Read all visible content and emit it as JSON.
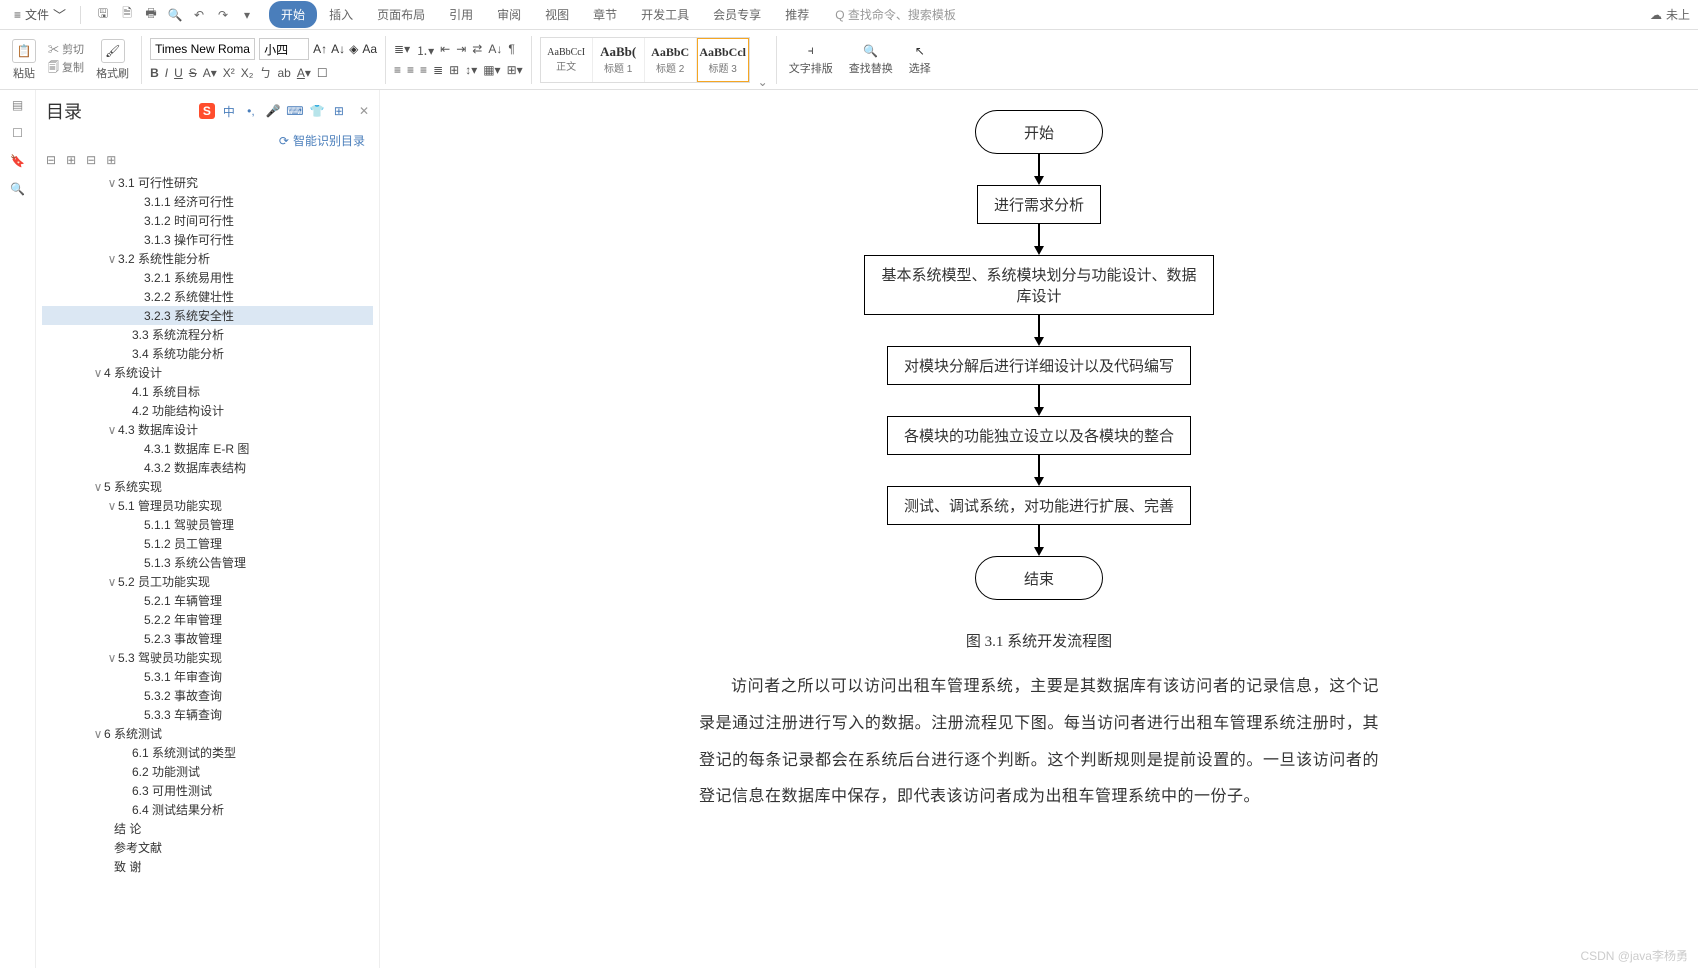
{
  "menubar": {
    "file": "文件",
    "tabs": [
      "开始",
      "插入",
      "页面布局",
      "引用",
      "审阅",
      "视图",
      "章节",
      "开发工具",
      "会员专享",
      "推荐"
    ],
    "active_tab": 0,
    "search_placeholder": "查找命令、搜索模板",
    "search_prefix": "Q",
    "not_logged": "未上"
  },
  "ribbon": {
    "paste": "粘贴",
    "cut": "剪切",
    "copy": "复制",
    "fmt_painter": "格式刷",
    "font_name": "Times New Roma",
    "font_size": "小四",
    "styles": [
      {
        "preview": "AaBbCcI",
        "label": "正文"
      },
      {
        "preview": "AaBb(",
        "label": "标题 1"
      },
      {
        "preview": "AaBbC",
        "label": "标题 2"
      },
      {
        "preview": "AaBbCcl",
        "label": "标题 3"
      }
    ],
    "text_layout": "文字排版",
    "find_replace": "查找替换",
    "select": "选择"
  },
  "sidebar": {
    "title": "目录",
    "smart": "智能识别目录",
    "ime_label": "中"
  },
  "tree": [
    {
      "pad": 64,
      "tw": "∨",
      "text": "3.1 可行性研究"
    },
    {
      "pad": 90,
      "tw": "",
      "text": "3.1.1 经济可行性"
    },
    {
      "pad": 90,
      "tw": "",
      "text": "3.1.2 时间可行性"
    },
    {
      "pad": 90,
      "tw": "",
      "text": "3.1.3 操作可行性"
    },
    {
      "pad": 64,
      "tw": "∨",
      "text": "3.2 系统性能分析"
    },
    {
      "pad": 90,
      "tw": "",
      "text": "3.2.1 系统易用性"
    },
    {
      "pad": 90,
      "tw": "",
      "text": "3.2.2 系统健壮性"
    },
    {
      "pad": 90,
      "tw": "",
      "text": "3.2.3 系统安全性",
      "selected": true
    },
    {
      "pad": 78,
      "tw": "",
      "text": "3.3 系统流程分析"
    },
    {
      "pad": 78,
      "tw": "",
      "text": "3.4 系统功能分析"
    },
    {
      "pad": 50,
      "tw": "∨",
      "text": "4  系统设计"
    },
    {
      "pad": 78,
      "tw": "",
      "text": "4.1 系统目标"
    },
    {
      "pad": 78,
      "tw": "",
      "text": "4.2 功能结构设计"
    },
    {
      "pad": 64,
      "tw": "∨",
      "text": "4.3 数据库设计"
    },
    {
      "pad": 90,
      "tw": "",
      "text": "4.3.1 数据库 E-R 图"
    },
    {
      "pad": 90,
      "tw": "",
      "text": "4.3.2 数据库表结构"
    },
    {
      "pad": 50,
      "tw": "∨",
      "text": "5  系统实现"
    },
    {
      "pad": 64,
      "tw": "∨",
      "text": "5.1 管理员功能实现"
    },
    {
      "pad": 90,
      "tw": "",
      "text": "5.1.1 驾驶员管理"
    },
    {
      "pad": 90,
      "tw": "",
      "text": "5.1.2 员工管理"
    },
    {
      "pad": 90,
      "tw": "",
      "text": "5.1.3 系统公告管理"
    },
    {
      "pad": 64,
      "tw": "∨",
      "text": "5.2 员工功能实现"
    },
    {
      "pad": 90,
      "tw": "",
      "text": "5.2.1 车辆管理"
    },
    {
      "pad": 90,
      "tw": "",
      "text": "5.2.2 年审管理"
    },
    {
      "pad": 90,
      "tw": "",
      "text": "5.2.3 事故管理"
    },
    {
      "pad": 64,
      "tw": "∨",
      "text": "5.3 驾驶员功能实现"
    },
    {
      "pad": 90,
      "tw": "",
      "text": "5.3.1 年审查询"
    },
    {
      "pad": 90,
      "tw": "",
      "text": "5.3.2 事故查询"
    },
    {
      "pad": 90,
      "tw": "",
      "text": "5.3.3 车辆查询"
    },
    {
      "pad": 50,
      "tw": "∨",
      "text": "6 系统测试"
    },
    {
      "pad": 78,
      "tw": "",
      "text": "6.1 系统测试的类型"
    },
    {
      "pad": 78,
      "tw": "",
      "text": "6.2 功能测试"
    },
    {
      "pad": 78,
      "tw": "",
      "text": "6.3 可用性测试"
    },
    {
      "pad": 78,
      "tw": "",
      "text": "6.4 测试结果分析"
    },
    {
      "pad": 60,
      "tw": "",
      "text": "结  论"
    },
    {
      "pad": 60,
      "tw": "",
      "text": "参考文献"
    },
    {
      "pad": 60,
      "tw": "",
      "text": "致  谢"
    }
  ],
  "flow": {
    "start": "开始",
    "b1": "进行需求分析",
    "b2": "基本系统模型、系统模块划分与功能设计、数据库设计",
    "b3": "对模块分解后进行详细设计以及代码编写",
    "b4": "各模块的功能独立设立以及各模块的整合",
    "b5": "测试、调试系统，对功能进行扩展、完善",
    "end": "结束"
  },
  "caption": "图 3.1 系统开发流程图",
  "bodytext": "访问者之所以可以访问出租车管理系统，主要是其数据库有该访问者的记录信息，这个记录是通过注册进行写入的数据。注册流程见下图。每当访问者进行出租车管理系统注册时，其登记的每条记录都会在系统后台进行逐个判断。这个判断规则是提前设置的。一旦该访问者的登记信息在数据库中保存，即代表该访问者成为出租车管理系统中的一份子。",
  "watermark": "CSDN @java李杨勇"
}
